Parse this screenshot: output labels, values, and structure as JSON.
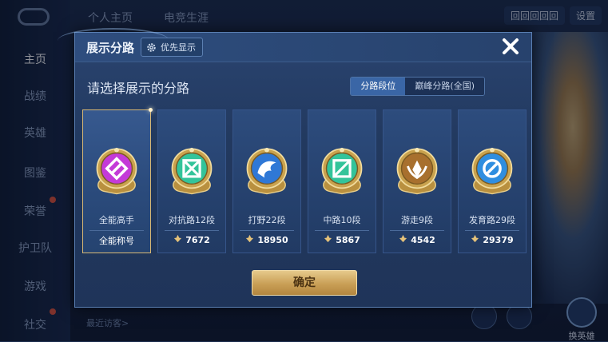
{
  "app": {
    "top_tabs": [
      "个人主页",
      "电竞生涯"
    ],
    "settings_label": "设置",
    "currency_label": "回回回回回",
    "sidebar_items": [
      "主页",
      "战绩",
      "英雄",
      "图鉴",
      "荣誉",
      "护卫队",
      "游戏",
      "社交"
    ],
    "recent_visitors_label": "最近访客>",
    "switch_hero_label": "换英雄"
  },
  "dialog": {
    "title": "展示分路",
    "priority_label": "优先显示",
    "prompt": "请选择展示的分路",
    "segments": [
      {
        "label": "分路段位",
        "active": true
      },
      {
        "label": "巅峰分路(全国)",
        "active": false
      }
    ],
    "cards": [
      {
        "name": "全能高手",
        "footer": "全能称号",
        "score": "",
        "selected": true,
        "icon": "all-round-emblem",
        "color": "#c43ad8"
      },
      {
        "name": "对抗路12段",
        "footer": "",
        "score": "7672",
        "selected": false,
        "icon": "clash-lane-emblem",
        "color": "#33c49a"
      },
      {
        "name": "打野22段",
        "footer": "",
        "score": "18950",
        "selected": false,
        "icon": "jungle-emblem",
        "color": "#2f78d6"
      },
      {
        "name": "中路10段",
        "footer": "",
        "score": "5867",
        "selected": false,
        "icon": "mid-lane-emblem",
        "color": "#33c49a"
      },
      {
        "name": "游走9段",
        "footer": "",
        "score": "4542",
        "selected": false,
        "icon": "roam-emblem",
        "color": "#a8702e"
      },
      {
        "name": "发育路29段",
        "footer": "",
        "score": "29379",
        "selected": false,
        "icon": "farm-lane-emblem",
        "color": "#2f8ee0"
      }
    ],
    "confirm_label": "确定"
  },
  "colors": {
    "accent_gold": "#d8b874",
    "dialog_bg": "#22395f",
    "active_segment": "#3a66a6"
  }
}
